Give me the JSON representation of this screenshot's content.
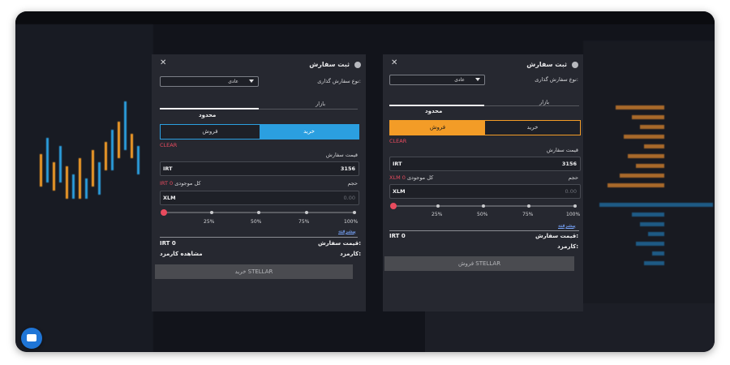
{
  "modal_buy": {
    "title": "ثبت سفارش",
    "order_type_label": "نوع سفارش گذاری:",
    "order_type_value": "عادی",
    "tab_market": "بازار",
    "tab_limit": "محدود",
    "side_sell": "فروش",
    "side_buy": "خرید",
    "clear": "CLEAR",
    "price_label": "قیمت سفارش",
    "price_currency": "IRT",
    "price_value": "3156",
    "balance_label": "کل موجودی",
    "balance_value": "IRT 0",
    "volume_label": "حجم",
    "volume_currency": "XLM",
    "volume_placeholder": "0.00",
    "pcts": [
      "25%",
      "50%",
      "75%",
      "100%"
    ],
    "advanced": "پیشرفته",
    "order_price_label": "قیمت سفارش:",
    "order_price_value": "IRT 0",
    "fee_label": "کارمزد:",
    "fee_link": "مشاهده کارمزد",
    "submit": "خرید STELLAR"
  },
  "modal_sell": {
    "title": "ثبت سفارش",
    "order_type_label": "نوع سفارش گذاری:",
    "order_type_value": "عادی",
    "tab_market": "بازار",
    "tab_limit": "محدود",
    "side_sell": "فروش",
    "side_buy": "خرید",
    "clear": "CLEAR",
    "price_label": "قیمت سفارش",
    "price_currency": "IRT",
    "price_value": "3156",
    "balance_label": "کل موجودی",
    "balance_value": "XLM 0",
    "volume_label": "حجم",
    "volume_currency": "XLM",
    "volume_placeholder": "0.00",
    "pcts": [
      "25%",
      "50%",
      "75%",
      "100%"
    ],
    "advanced": "پیشرفته",
    "order_price_label": "قیمت سفارش:",
    "order_price_value": "IRT 0",
    "fee_label": "کارمزد:",
    "submit": "فروش STELLAR"
  },
  "colors": {
    "buy": "#2b9fe0",
    "sell": "#f39c27",
    "red": "#e84b5e",
    "bg": "#12141b"
  },
  "icons": [
    "close-icon",
    "info-dot-icon",
    "chevron-down-icon",
    "chat-icon"
  ]
}
